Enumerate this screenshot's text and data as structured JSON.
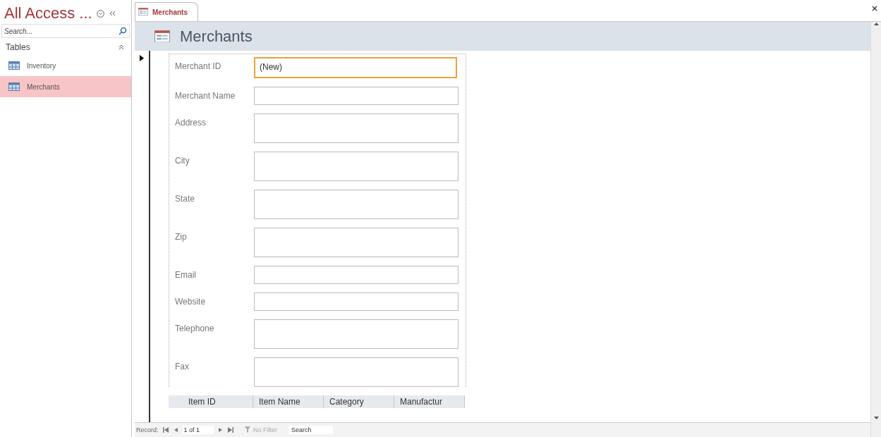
{
  "nav_pane": {
    "title": "All Access ...",
    "search": {
      "placeholder": "Search..."
    },
    "group": {
      "label": "Tables",
      "expanded": true
    },
    "items": [
      {
        "label": "Inventory",
        "selected": false
      },
      {
        "label": "Merchants",
        "selected": true
      }
    ]
  },
  "tabs": [
    {
      "label": "Merchants",
      "selected": true
    }
  ],
  "form": {
    "title": "Merchants",
    "fields": [
      {
        "label": "Merchant ID",
        "kind": "single",
        "value": "(New)",
        "focused": true
      },
      {
        "label": "Merchant Name",
        "kind": "single",
        "focused": false
      },
      {
        "label": "Address",
        "kind": "multi",
        "focused": false
      },
      {
        "label": "City",
        "kind": "multi",
        "focused": false
      },
      {
        "label": "State",
        "kind": "multi",
        "focused": false
      },
      {
        "label": "Zip",
        "kind": "multi",
        "focused": false
      },
      {
        "label": "Email",
        "kind": "single",
        "focused": false
      },
      {
        "label": "Website",
        "kind": "single",
        "focused": false
      },
      {
        "label": "Telephone",
        "kind": "multi",
        "focused": false
      },
      {
        "label": "Fax",
        "kind": "multi",
        "focused": false
      }
    ],
    "subform_columns": [
      "Item ID",
      "Item Name",
      "Category",
      "Manufactur"
    ]
  },
  "record_bar": {
    "label": "Record:",
    "position": "1 of 1",
    "filter": "No Filter",
    "search": "Search"
  }
}
